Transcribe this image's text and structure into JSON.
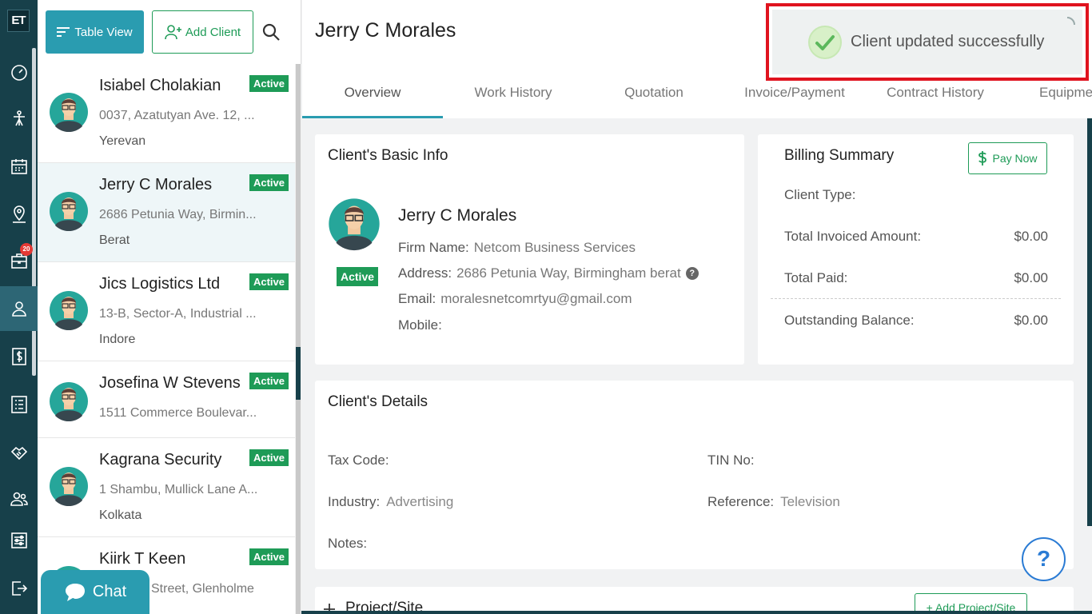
{
  "app": {
    "logo": "ET",
    "notification_count": "20"
  },
  "rail": [
    "dashboard-icon",
    "funnel-icon",
    "calendar-icon",
    "map-pin-icon",
    "briefcase-icon",
    "user-icon",
    "dollar-icon",
    "list-icon",
    "handshake-icon",
    "team-icon",
    "settings-icon",
    "logout-icon"
  ],
  "toolbar": {
    "table_view": "Table View",
    "add_client": "Add Client"
  },
  "clients": [
    {
      "name": "Isiabel  Cholakian",
      "addr1": "0037, Azatutyan Ave. 12, ...",
      "addr2": "Yerevan",
      "status": "Active"
    },
    {
      "name": "Jerry C Morales",
      "addr1": "2686 Petunia Way, Birmin...",
      "addr2": "Berat",
      "status": "Active"
    },
    {
      "name": "Jics Logistics Ltd",
      "addr1": "13-B, Sector-A, Industrial ...",
      "addr2": "Indore",
      "status": "Active"
    },
    {
      "name": "Josefina W Stevens",
      "addr1": "1511 Commerce Boulevar...",
      "addr2": "",
      "status": "Active"
    },
    {
      "name": "Kagrana Security",
      "addr1": "1 Shambu, Mullick Lane A...",
      "addr2": "Kolkata",
      "status": "Active"
    },
    {
      "name": "Kiirk T Keen",
      "addr1": "Street, Glenholme",
      "addr2": "",
      "status": "Active"
    }
  ],
  "chat": {
    "label": "Chat"
  },
  "header": {
    "title": "Jerry C Morales"
  },
  "tabs": [
    "Overview",
    "Work History",
    "Quotation",
    "Invoice/Payment",
    "Contract History",
    "Equipme"
  ],
  "toast": {
    "message": "Client updated successfully"
  },
  "basic_info": {
    "title": "Client's Basic Info",
    "name": "Jerry C Morales",
    "status": "Active",
    "firm_label": "Firm Name:",
    "firm_value": "Netcom Business Services",
    "address_label": "Address:",
    "address_value": "2686 Petunia Way, Birmingham berat",
    "email_label": "Email:",
    "email_value": "moralesnetcomrtyu@gmail.com",
    "mobile_label": "Mobile:",
    "mobile_value": ""
  },
  "billing": {
    "title": "Billing Summary",
    "pay_now": "Pay Now",
    "client_type_label": "Client Type:",
    "invoiced_label": "Total Invoiced Amount:",
    "invoiced_value": "$0.00",
    "paid_label": "Total Paid:",
    "paid_value": "$0.00",
    "outstanding_label": "Outstanding Balance:",
    "outstanding_value": "$0.00"
  },
  "details": {
    "title": "Client's Details",
    "tax_label": "Tax Code:",
    "tax_value": "",
    "tin_label": "TIN No:",
    "tin_value": "",
    "industry_label": "Industry:",
    "industry_value": "Advertising",
    "reference_label": "Reference:",
    "reference_value": "Television",
    "notes_label": "Notes:",
    "notes_value": ""
  },
  "project": {
    "title": "Project/Site",
    "add_label": "Add Project/Site"
  },
  "help": {
    "label": "?"
  },
  "colors": {
    "teal": "#2a9cb0",
    "green": "#1e9b57",
    "dark": "#17404a",
    "alert_red": "#e0131e"
  }
}
